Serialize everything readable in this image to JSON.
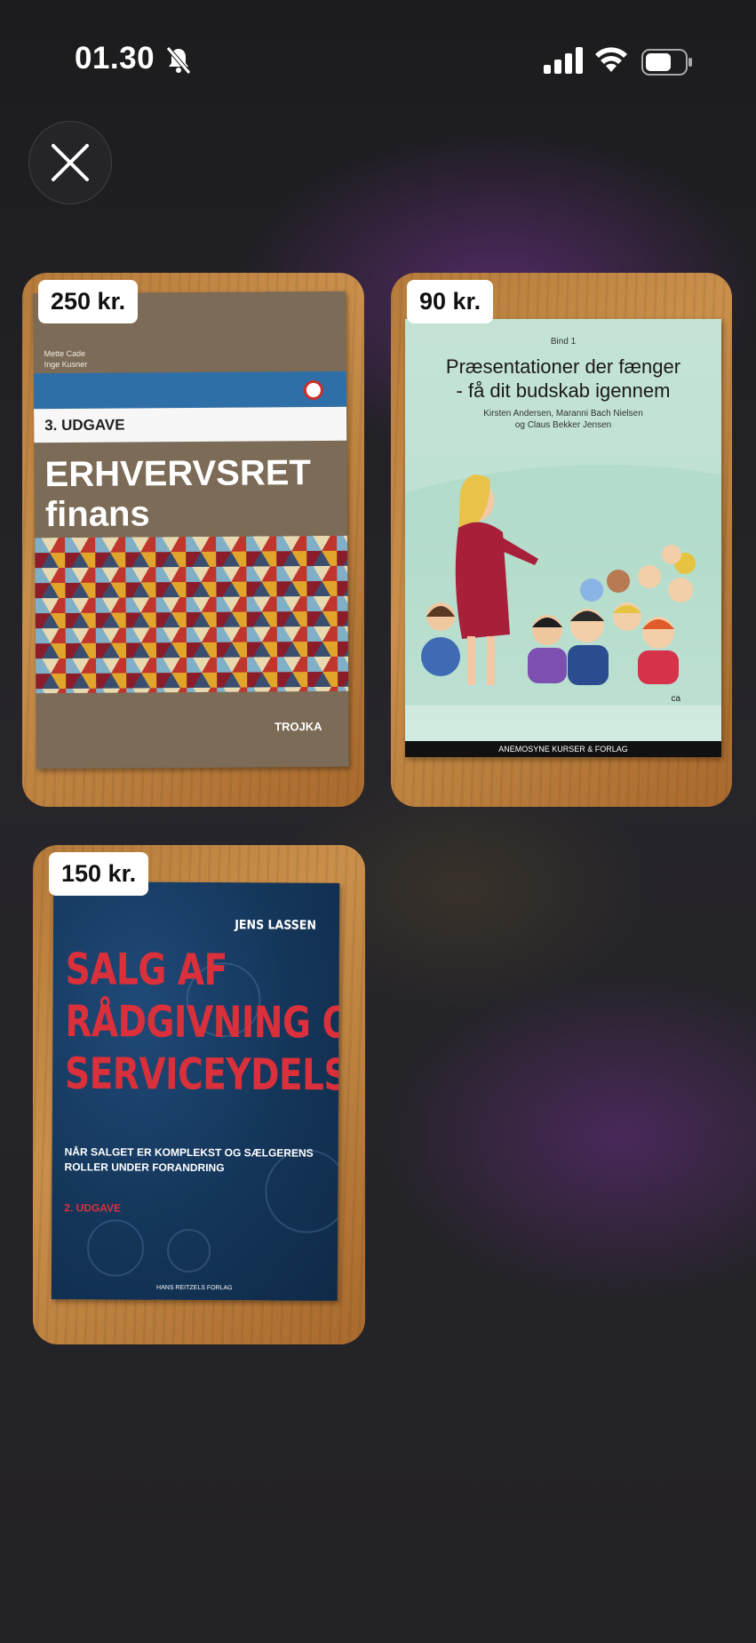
{
  "status_bar": {
    "time": "01.30"
  },
  "items": [
    {
      "price": "250 kr.",
      "book": {
        "authors": [
          "Mette Cade",
          "Inge Kusner"
        ],
        "edition": "3. UDGAVE",
        "title_line1": "ERHVERVSRET",
        "title_line2": "finans",
        "publisher": "TROJKA"
      }
    },
    {
      "price": "90 kr.",
      "book": {
        "volume": "Bind 1",
        "title_line1": "Præsentationer der fænger",
        "title_line2": "- få dit budskab igennem",
        "authors_line1": "Kirsten Andersen, Maranni Bach Nielsen",
        "authors_line2": "og Claus Bekker Jensen",
        "signature": "ca",
        "publisher": "ANEMOSYNE KURSER & FORLAG"
      }
    },
    {
      "price": "150 kr.",
      "book": {
        "author": "JENS LASSEN",
        "title_line1": "SALG AF",
        "title_line2": "RÅDGIVNING OG",
        "title_line3": "SERVICEYDELSER",
        "subtitle": "NÅR SALGET ER KOMPLEKST OG SÆLGERENS ROLLER UNDER FORANDRING",
        "edition": "2. UDGAVE",
        "publisher": "HANS REITZELS FORLAG"
      }
    }
  ]
}
